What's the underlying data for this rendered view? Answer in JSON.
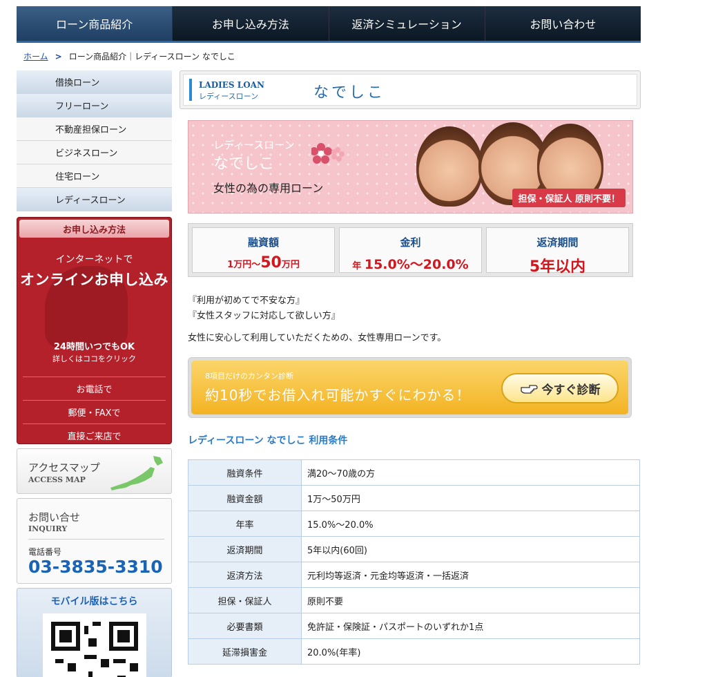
{
  "topnav": {
    "items": [
      "ローン商品紹介",
      "お申し込み方法",
      "返済シミュレーション",
      "お問い合わせ"
    ]
  },
  "breadcrumb": {
    "home": "ホーム",
    "separator": ">",
    "path": "ローン商品紹介｜レディースローン なでしこ"
  },
  "sidebar": {
    "menu": [
      "借換ローン",
      "フリーローン",
      "不動産担保ローン",
      "ビジネスローン",
      "住宅ローン",
      "レディースローン"
    ],
    "apply": {
      "header": "お申し込み方法",
      "internet": "インターネットで",
      "online": "オンラインお申し込み",
      "allday": "24時間いつでもOK",
      "detail": "詳しくはココをクリック",
      "phone": "お電話で",
      "mail": "郵便・FAXで",
      "visit": "直接ご来店で"
    },
    "access": {
      "title": "アクセスマップ",
      "subtitle": "ACCESS MAP"
    },
    "inquiry": {
      "title": "お問い合せ",
      "subtitle": "INQUIRY",
      "tel_label": "電話番号",
      "tel": "03-3835-3310"
    },
    "mobile": {
      "title": "モバイル版はこちら"
    }
  },
  "main": {
    "title": {
      "en": "LADIES LOAN",
      "jp": "レディースローン",
      "name": "なでしこ"
    },
    "banner": {
      "line1": "レディースローン",
      "line2": "なでしこ",
      "line3": "女性の為の専用ローン",
      "badge": "担保・保証人 原則不要！"
    },
    "specs": [
      {
        "label": "融資額",
        "value_a": "1万円～",
        "value_b": "50",
        "value_c": "万円"
      },
      {
        "label": "金利",
        "value_a": "年",
        "value_b": "15.0%～20.0%"
      },
      {
        "label": "返済期間",
        "value_b": "5年以内"
      }
    ],
    "desc": {
      "line1": "『利用が初めてで不安な方』",
      "line2": "『女性スタッフに対応して欲しい方』",
      "line3": "女性に安心して利用していただくための、女性専用ローンです。"
    },
    "diagnosis": {
      "small": "8項目だけのカンタン診断",
      "large": "約10秒でお借入れ可能かすぐにわかる！",
      "button": "今すぐ診断"
    },
    "conditions_title": "レディースローン なでしこ 利用条件",
    "conditions": [
      {
        "k": "融資条件",
        "v": "満20～70歳の方"
      },
      {
        "k": "融資金額",
        "v": "1万～50万円"
      },
      {
        "k": "年率",
        "v": "15.0%～20.0%"
      },
      {
        "k": "返済期間",
        "v": "5年以内(60回)"
      },
      {
        "k": "返済方法",
        "v": "元利均等返済・元金均等返済・一括返済"
      },
      {
        "k": "担保・保証人",
        "v": "原則不要"
      },
      {
        "k": "必要書類",
        "v": "免許証・保険証・パスポートのいずれか1点"
      },
      {
        "k": "延滞損害金",
        "v": "20.0%(年率)"
      }
    ]
  },
  "colors": {
    "nav": "#0b1723",
    "accent_blue": "#2a7ac8",
    "red": "#b5212b",
    "pink": "#f6c5cb",
    "yellow": "#f3b322"
  }
}
